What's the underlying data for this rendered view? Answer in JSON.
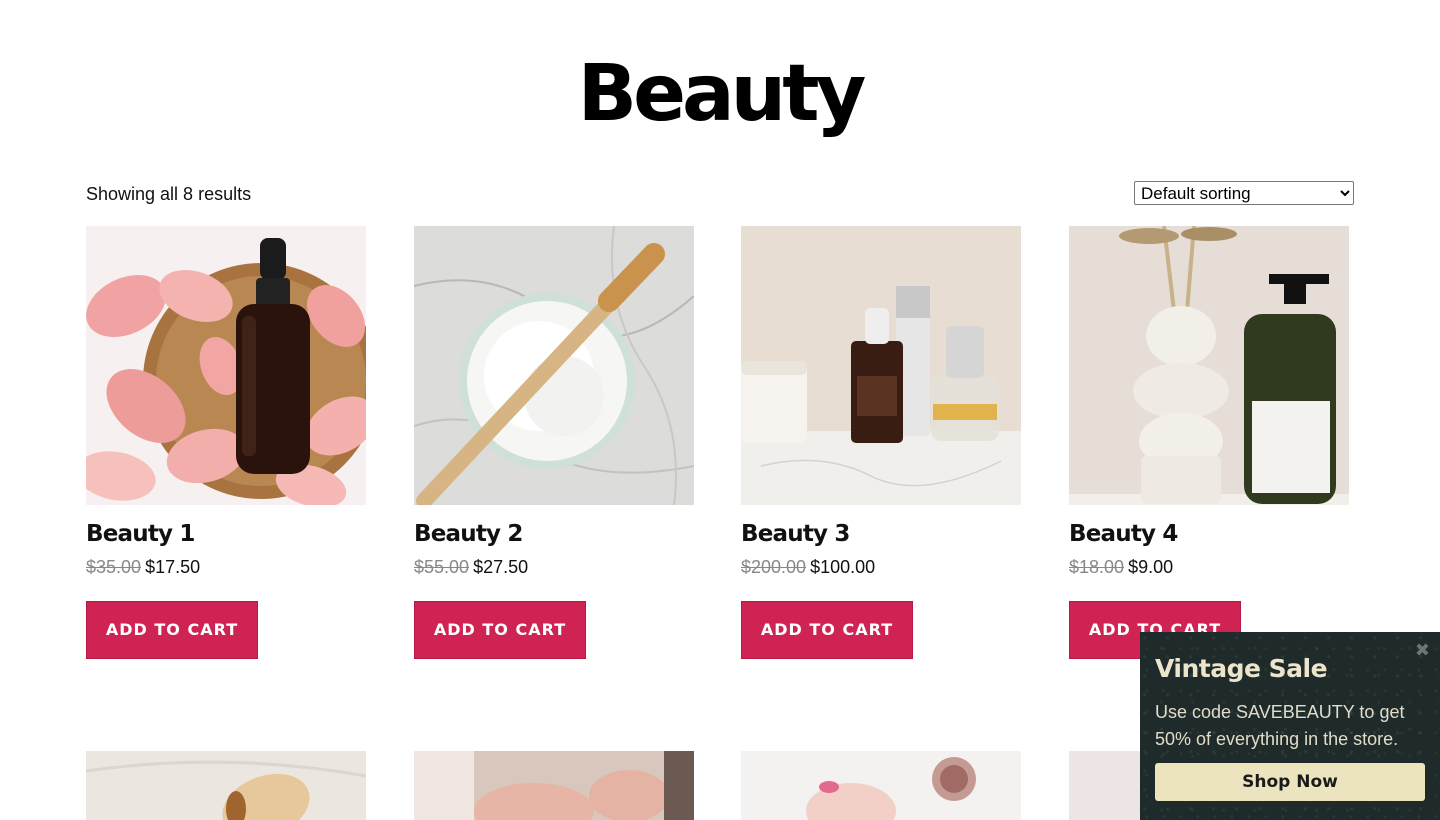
{
  "page": {
    "title": "Beauty"
  },
  "toolbar": {
    "result_count": "Showing all 8 results",
    "sort_options": [
      "Default sorting"
    ],
    "sort_selected": "Default sorting"
  },
  "products": [
    {
      "title": "Beauty 1",
      "old_price": "$35.00",
      "price": "$17.50",
      "button": "ADD TO CART"
    },
    {
      "title": "Beauty 2",
      "old_price": "$55.00",
      "price": "$27.50",
      "button": "ADD TO CART"
    },
    {
      "title": "Beauty 3",
      "old_price": "$200.00",
      "price": "$100.00",
      "button": "ADD TO CART"
    },
    {
      "title": "Beauty 4",
      "old_price": "$18.00",
      "price": "$9.00",
      "button": "ADD TO CART"
    }
  ],
  "popup": {
    "title": "Vintage Sale",
    "text": "Use code SAVEBEAUTY to get 50% of everything in the store.",
    "button": "Shop Now",
    "close_icon": "close-icon"
  },
  "colors": {
    "button_bg": "#cf2453",
    "popup_bg": "#1e2b2a",
    "popup_button_bg": "#ece4bf"
  }
}
